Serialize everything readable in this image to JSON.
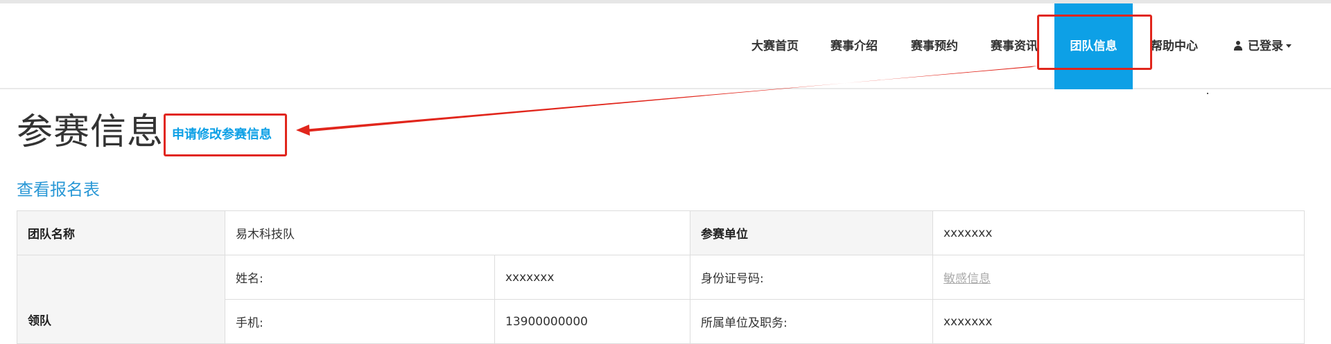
{
  "nav": {
    "items": [
      {
        "label": "大赛首页"
      },
      {
        "label": "赛事介绍"
      },
      {
        "label": "赛事预约"
      },
      {
        "label": "赛事资讯"
      },
      {
        "label": "团队信息",
        "active": true
      },
      {
        "label": "帮助中心"
      }
    ],
    "user": {
      "label": "已登录",
      "icon": "user-icon"
    }
  },
  "page": {
    "title": "参赛信息",
    "apply_link": "申请修改参赛信息",
    "view_link": "查看报名表"
  },
  "table": {
    "team_name_label": "团队名称",
    "team_name_value": "易木科技队",
    "org_label": "参赛单位",
    "org_value": "xxxxxxx",
    "leader_label": "领队",
    "name_label": "姓名:",
    "name_value": "xxxxxxx",
    "id_label": "身份证号码:",
    "id_value": "敏感信息",
    "phone_label": "手机:",
    "phone_value": "13900000000",
    "job_label": "所属单位及职务:",
    "job_value": "xxxxxxx"
  },
  "colors": {
    "accent": "#0da0e6",
    "annotation": "#e1261c",
    "label_bg": "#f5f5f5"
  }
}
